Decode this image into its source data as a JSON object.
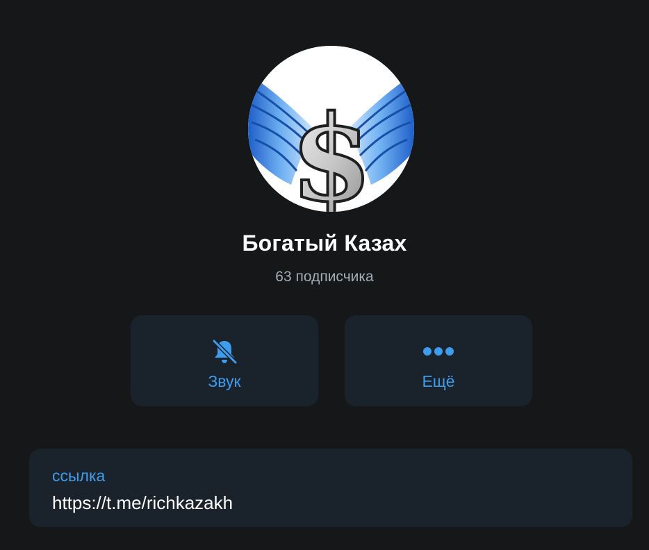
{
  "channel": {
    "name": "Богатый Казах",
    "subscribers": "63 подписчика",
    "avatar_icon": "winged-dollar-icon"
  },
  "actions": [
    {
      "label": "Звук",
      "icon": "bell-muted-icon"
    },
    {
      "label": "Ещё",
      "icon": "more-dots-icon"
    }
  ],
  "info": {
    "link_label": "ссылка",
    "link_value": "https://t.me/richkazakh"
  },
  "colors": {
    "background": "#151719",
    "card": "#1a222b",
    "accent": "#3e9ded",
    "subtitle": "#a3adb8",
    "text": "#ffffff"
  }
}
